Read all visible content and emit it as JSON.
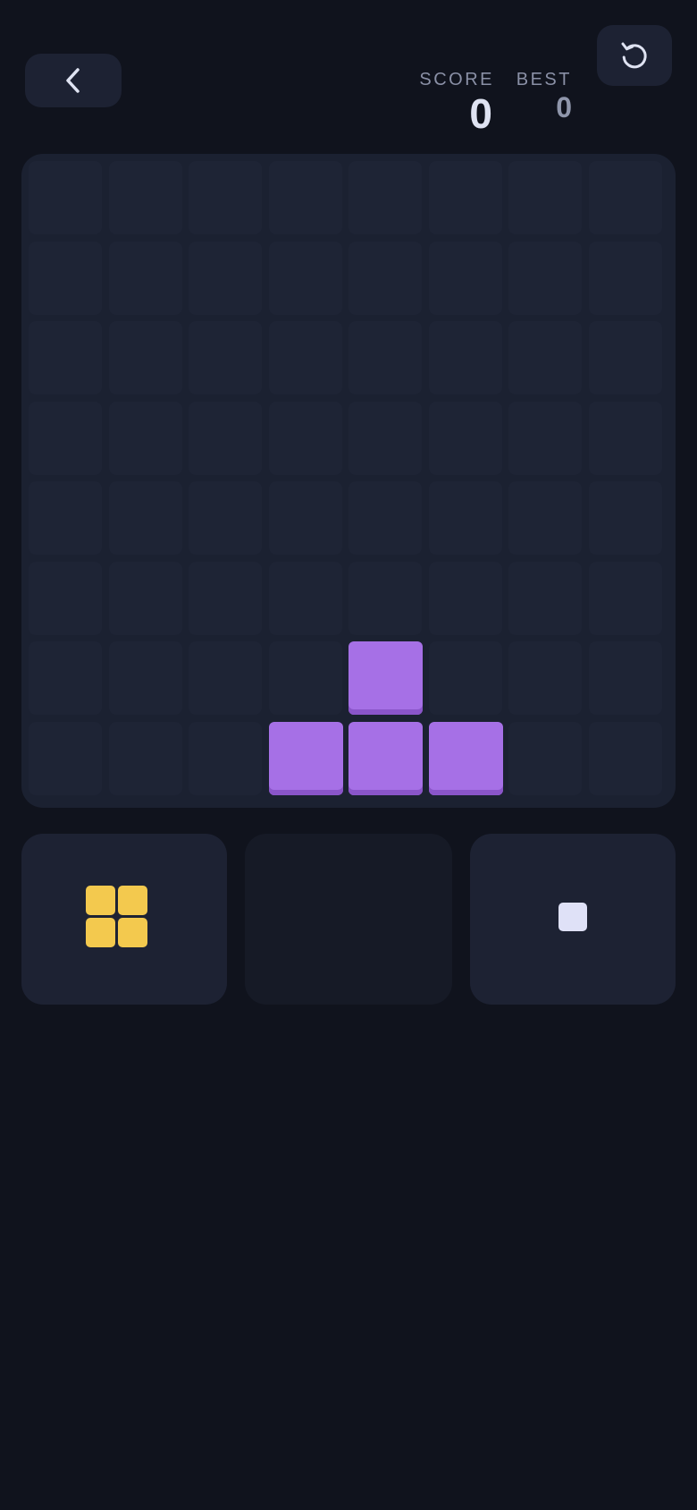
{
  "header": {
    "back_icon": "chevron-left-icon",
    "restart_icon": "restart-icon",
    "score_label": "SCORE",
    "score_value": "0",
    "best_label": "BEST",
    "best_value": "0"
  },
  "board": {
    "rows": 8,
    "cols": 8,
    "cell_color": "#1e2435",
    "filled_cells": [
      {
        "row": 6,
        "col": 4,
        "color": "#a670e6"
      },
      {
        "row": 7,
        "col": 3,
        "color": "#a670e6"
      },
      {
        "row": 7,
        "col": 4,
        "color": "#a670e6"
      },
      {
        "row": 7,
        "col": 5,
        "color": "#a670e6"
      }
    ]
  },
  "tray": {
    "slots": [
      {
        "piece": "square-2x2",
        "color": "#f3c94e",
        "cells": [
          [
            0,
            0
          ],
          [
            0,
            1
          ],
          [
            1,
            0
          ],
          [
            1,
            1
          ]
        ]
      },
      {
        "piece": "empty"
      },
      {
        "piece": "single",
        "color": "#dfe1f7",
        "cells": [
          [
            0,
            0
          ]
        ]
      }
    ]
  },
  "colors": {
    "background": "#10131d",
    "panel": "#1d2233",
    "accent_purple": "#a670e6",
    "accent_yellow": "#f3c94e"
  }
}
